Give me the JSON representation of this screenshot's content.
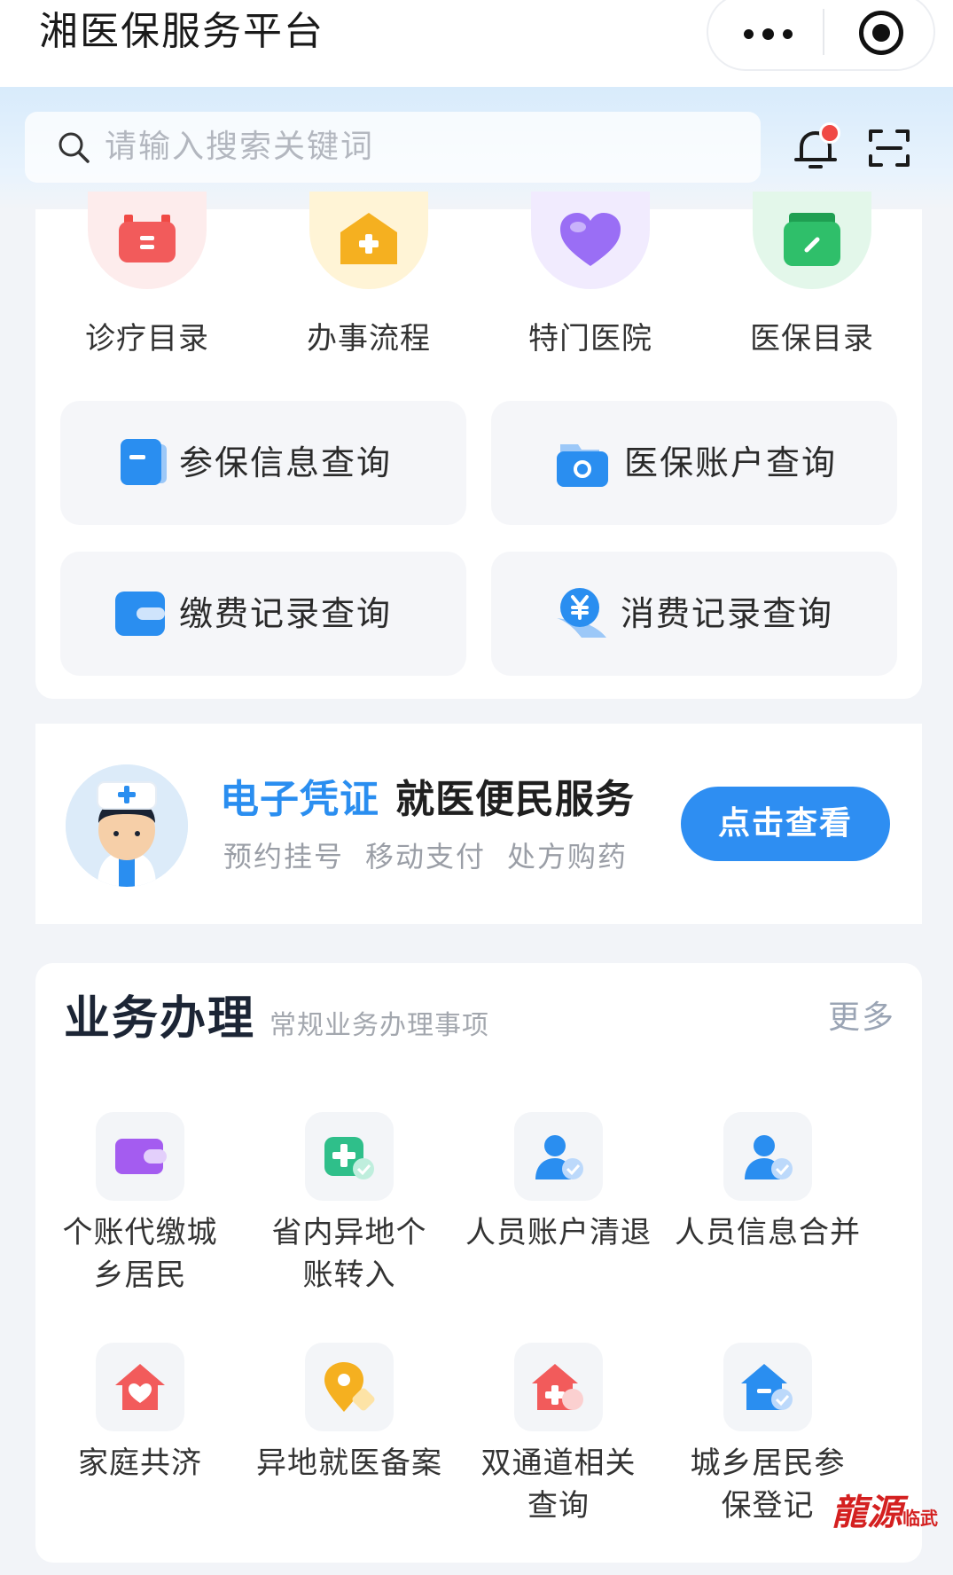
{
  "app": {
    "title": "湘医保服务平台"
  },
  "search": {
    "placeholder": "请输入搜索关键词"
  },
  "categories": [
    {
      "label": "诊疗目录",
      "icon": "briefcase-icon",
      "color": "#f25b5b"
    },
    {
      "label": "办事流程",
      "icon": "house-plus-icon",
      "color": "#f5b020"
    },
    {
      "label": "特门医院",
      "icon": "heart-icon",
      "color": "#9a6ef5"
    },
    {
      "label": "医保目录",
      "icon": "notebook-icon",
      "color": "#2fbf6a"
    }
  ],
  "queries": [
    {
      "label": "参保信息查询",
      "icon": "document-icon"
    },
    {
      "label": "医保账户查询",
      "icon": "folder-icon"
    },
    {
      "label": "缴费记录查询",
      "icon": "card-icon"
    },
    {
      "label": "消费记录查询",
      "icon": "yuan-icon"
    }
  ],
  "banner": {
    "highlight": "电子凭证",
    "title": "就医便民服务",
    "tags": [
      "预约挂号",
      "移动支付",
      "处方购药"
    ],
    "button": "点击查看"
  },
  "business": {
    "title": "业务办理",
    "subtitle": "常规业务办理事项",
    "more": "更多",
    "items": [
      {
        "label": "个账代缴城乡居民",
        "icon": "wallet-icon"
      },
      {
        "label": "省内异地个账转入",
        "icon": "medical-transfer-icon"
      },
      {
        "label": "人员账户清退",
        "icon": "person-check-icon"
      },
      {
        "label": "人员信息合并",
        "icon": "person-check-icon"
      },
      {
        "label": "家庭共济",
        "icon": "family-home-icon"
      },
      {
        "label": "异地就医备案",
        "icon": "location-pin-icon"
      },
      {
        "label": "双通道相关查询",
        "icon": "hospital-home-icon"
      },
      {
        "label": "城乡居民参保登记",
        "icon": "register-home-icon"
      }
    ]
  },
  "watermark": {
    "text": "龍源",
    "sub": "临武"
  },
  "colors": {
    "accent": "#2e8ef2",
    "highlight": "#2a8ef0",
    "notification": "#f04a45"
  }
}
